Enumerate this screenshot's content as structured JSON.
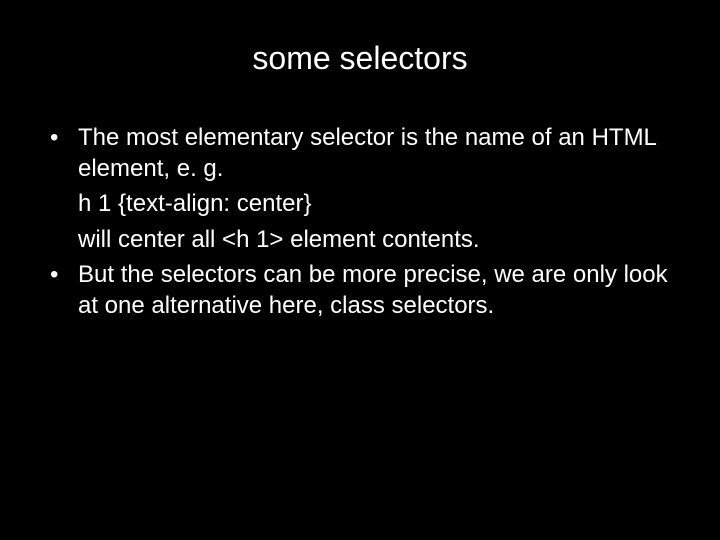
{
  "slide": {
    "title": "some selectors",
    "bullets": [
      {
        "marker": "•",
        "text": "The most elementary selector is the name of an HTML element, e. g.",
        "sublines": [
          "h 1 {text-align: center}",
          "will center all <h 1> element contents."
        ]
      },
      {
        "marker": "•",
        "text": "But the selectors can be more precise, we are only look at one alternative here, class selectors.",
        "sublines": []
      }
    ]
  }
}
